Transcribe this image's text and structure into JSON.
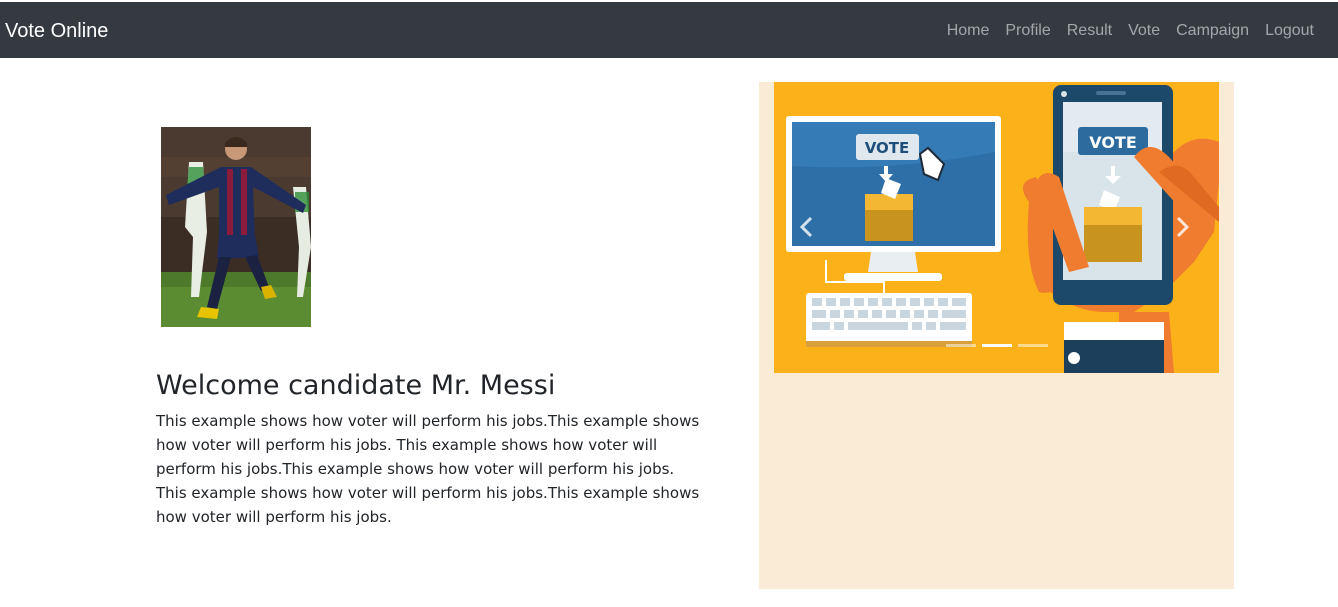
{
  "navbar": {
    "brand": "Vote Online",
    "links": [
      "Home",
      "Profile",
      "Result",
      "Vote",
      "Campaign",
      "Logout"
    ]
  },
  "profile": {
    "photo_alt": "candidate photo"
  },
  "main": {
    "heading": "Welcome candidate Mr. Messi",
    "description": "This example shows how voter will perform his jobs.This example shows how voter will perform his jobs. This example shows how voter will perform his jobs.This example shows how voter will perform his jobs. This example shows how voter will perform his jobs.This example shows how voter will perform his jobs."
  },
  "carousel": {
    "vote_label_monitor": "VOTE",
    "vote_label_phone": "VOTE",
    "slide_count": 3,
    "active_index": 1
  },
  "colors": {
    "navbar_bg": "#343a40",
    "panel_bg": "#faebd7",
    "carousel_bg": "#fbb21a"
  }
}
